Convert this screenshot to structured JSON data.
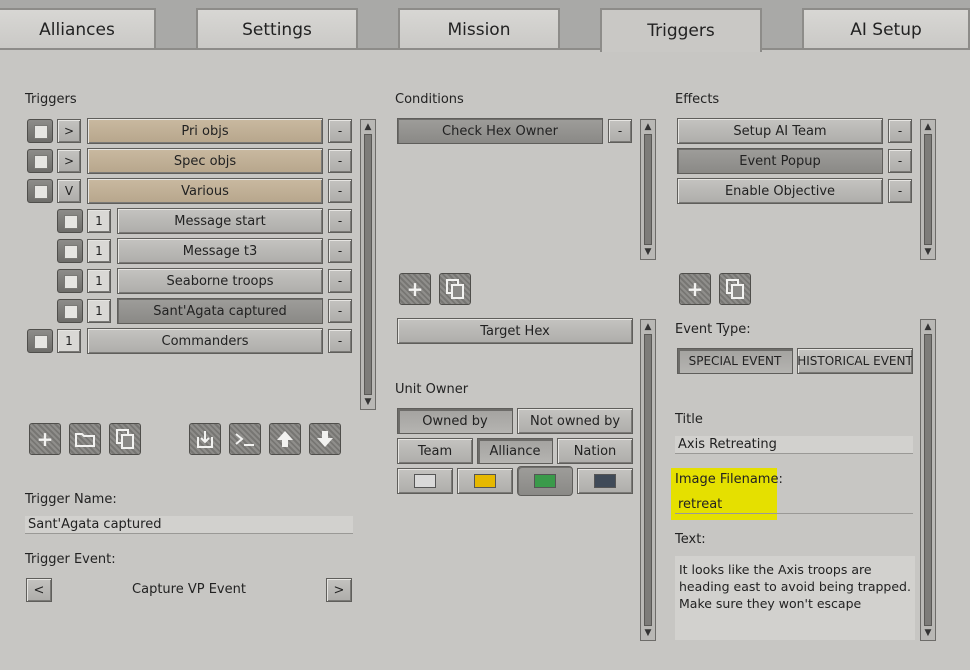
{
  "tabs": [
    {
      "label": "Alliances",
      "active": false
    },
    {
      "label": "Settings",
      "active": false
    },
    {
      "label": "Mission",
      "active": false
    },
    {
      "label": "Triggers",
      "active": true
    },
    {
      "label": "AI Setup",
      "active": false
    }
  ],
  "triggers": {
    "section_label": "Triggers",
    "items": [
      {
        "toggle": ">",
        "label": "Pri objs",
        "remove": "-"
      },
      {
        "toggle": ">",
        "label": "Spec objs",
        "remove": "-"
      },
      {
        "toggle": "V",
        "label": "Various",
        "remove": "-"
      },
      {
        "toggle": "1",
        "label": "Message start",
        "remove": "-"
      },
      {
        "toggle": "1",
        "label": "Message t3",
        "remove": "-"
      },
      {
        "toggle": "1",
        "label": "Seaborne troops",
        "remove": "-"
      },
      {
        "toggle": "1",
        "label": "Sant'Agata captured",
        "remove": "-"
      },
      {
        "toggle": "1",
        "label": "Commanders",
        "remove": "-"
      }
    ],
    "name_label": "Trigger Name:",
    "name_value": "Sant'Agata captured",
    "event_label": "Trigger Event:",
    "event_prev": "<",
    "event_value": "Capture VP Event",
    "event_next": ">"
  },
  "conditions": {
    "section_label": "Conditions",
    "items": [
      {
        "label": "Check Hex Owner",
        "remove": "-"
      }
    ],
    "target_hex": "Target Hex",
    "unit_owner_label": "Unit Owner",
    "owned_by": "Owned by",
    "not_owned_by": "Not owned by",
    "team": "Team",
    "alliance": "Alliance",
    "nation": "Nation",
    "colors": [
      "#d9d9d9",
      "#e6b800",
      "#3a9a4a",
      "#3f4a58"
    ]
  },
  "effects": {
    "section_label": "Effects",
    "items": [
      {
        "label": "Setup AI Team",
        "remove": "-"
      },
      {
        "label": "Event Popup",
        "remove": "-"
      },
      {
        "label": "Enable Objective",
        "remove": "-"
      }
    ],
    "event_type_label": "Event Type:",
    "special_event": "SPECIAL EVENT",
    "historical_event": "HISTORICAL EVENT",
    "title_label": "Title",
    "title_value": "Axis Retreating",
    "image_label": "Image Filename:",
    "image_value": "retreat",
    "text_label": "Text:",
    "text_value": "It looks like the Axis troops are heading east to avoid being trapped. Make sure they won't escape"
  },
  "icons": {
    "add": "plus-icon",
    "folder": "folder-icon",
    "copy": "copy-icon",
    "import": "import-icon",
    "console": "console-icon",
    "up": "arrow-up-icon",
    "down": "arrow-down-icon"
  }
}
